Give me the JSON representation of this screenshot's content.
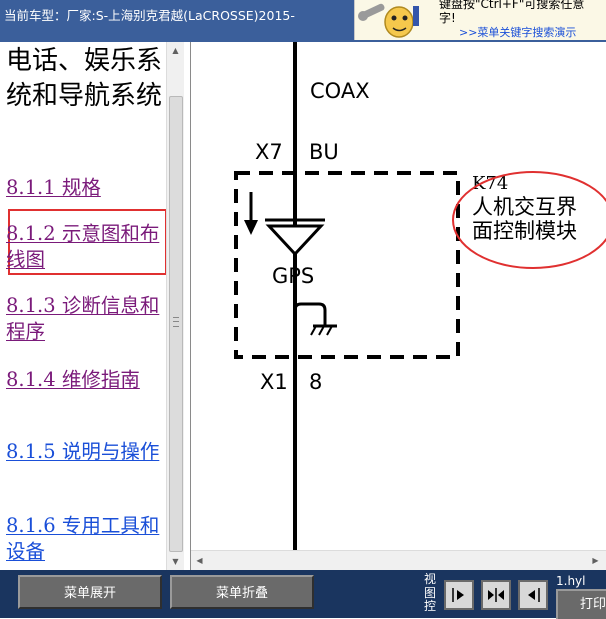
{
  "header": {
    "title": "当前车型：厂家:S-上海别克君越(LaCROSSE)2015-",
    "banner_line1": "键盘按\"Ctrl+F\"可搜索任意",
    "banner_line2": "字!",
    "banner_link": ">>菜单关键字搜索演示"
  },
  "sidebar": {
    "section_title": "电话、娱乐系统和导航系统",
    "items": [
      {
        "label": "8.1.1 规格",
        "state": "visited"
      },
      {
        "label": "8.1.2 示意图和布线图",
        "state": "visited",
        "highlighted": true
      },
      {
        "label": "8.1.3 诊断信息和程序",
        "state": "visited"
      },
      {
        "label": "8.1.4 维修指南",
        "state": "visited"
      },
      {
        "label": "8.1.5 说明与操作",
        "state": "normal"
      },
      {
        "label": "8.1.6 专用工具和设备",
        "state": "normal"
      }
    ]
  },
  "diagram": {
    "coax_label": "COAX",
    "connector_top_id": "X7",
    "connector_top_wire": "BU",
    "antenna_label": "GPS",
    "connector_bottom_id": "X1",
    "connector_bottom_pin": "8",
    "module_id": "K74",
    "module_name_line1": "人机交互界",
    "module_name_line2": "面控制模块"
  },
  "toolbar": {
    "expand_label": "菜单展开",
    "collapse_label": "菜单折叠",
    "view_label": "视图控",
    "file_label": "1.hyl",
    "print_label": "打印"
  },
  "colors": {
    "topbar": "#3b5f9b",
    "bottombar": "#1a355f",
    "visited_link": "#7a1a7a",
    "link": "#1a4fd8",
    "highlight": "#e03030"
  }
}
